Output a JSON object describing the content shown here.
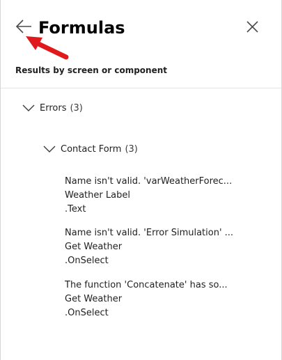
{
  "header": {
    "title": "Formulas"
  },
  "subtitle": "Results by screen or component",
  "tree": {
    "errors": {
      "label": "Errors",
      "count": "(3)"
    },
    "screen": {
      "label": "Contact Form",
      "count": "(3)"
    }
  },
  "results": [
    {
      "message": "Name isn't valid. 'varWeatherForec...",
      "control": "Weather Label",
      "property": ".Text"
    },
    {
      "message": "Name isn't valid. 'Error Simulation' ...",
      "control": "Get Weather",
      "property": ".OnSelect"
    },
    {
      "message": "The function 'Concatenate' has so...",
      "control": "Get Weather",
      "property": ".OnSelect"
    }
  ],
  "icons": {
    "back": "arrow-left-icon",
    "close": "close-icon",
    "expand": "chevron-down-icon",
    "annotation": "red-pointer-arrow"
  },
  "colors": {
    "annotation_red": "#e0191b",
    "text": "#1f1f1f"
  }
}
